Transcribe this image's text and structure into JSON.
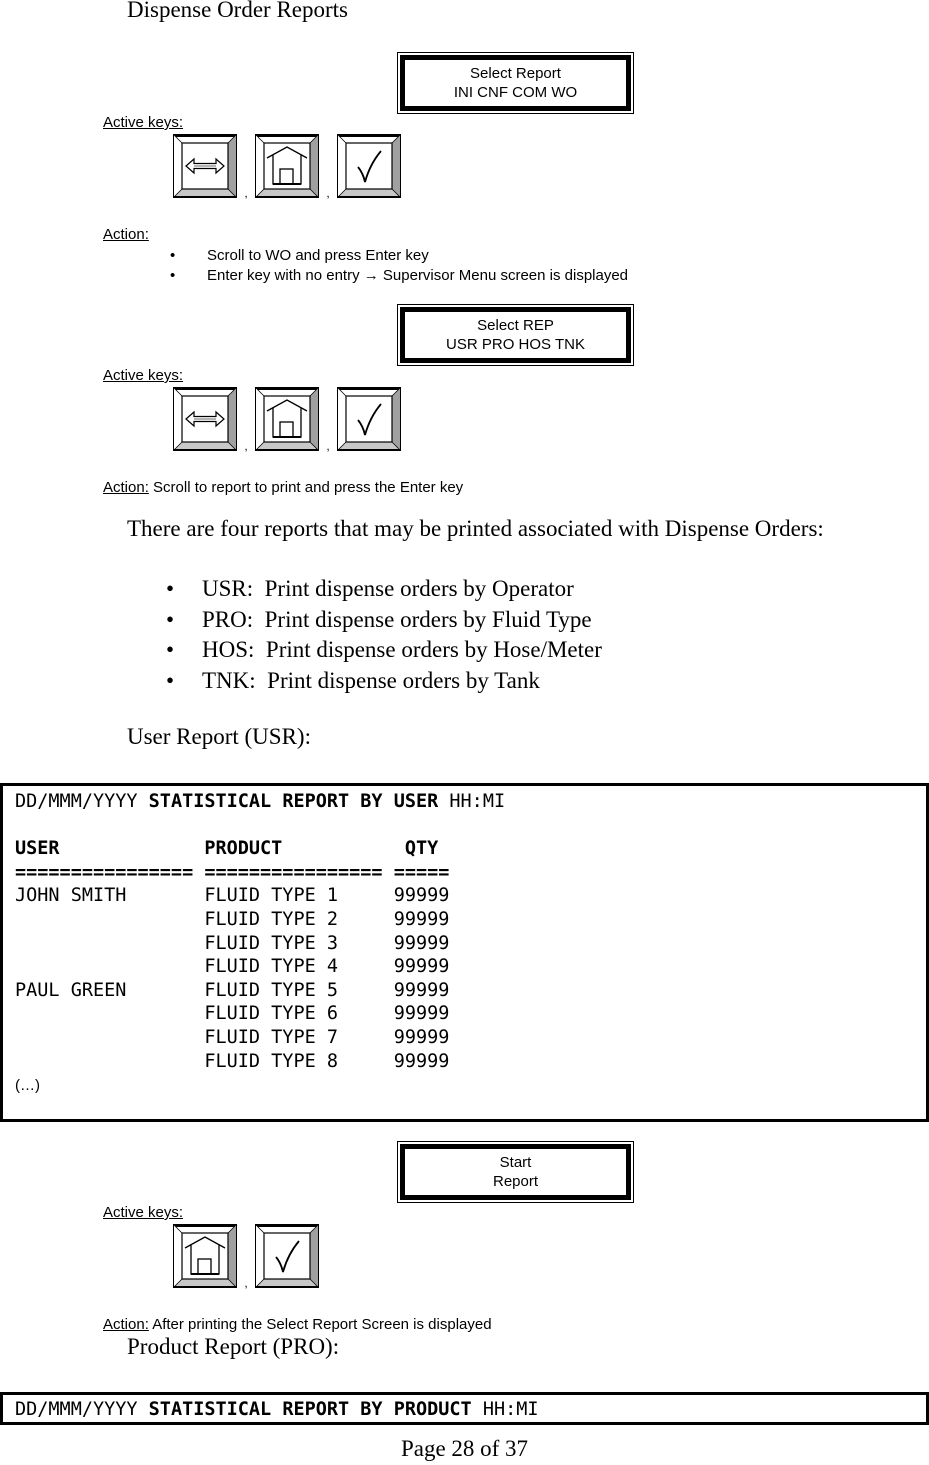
{
  "section_title": "Dispense Order Reports",
  "labels": {
    "active_keys": "Active keys:",
    "action": "Action:"
  },
  "icons": {
    "scroll": "left-right-arrow-icon",
    "home": "home-icon",
    "enter": "check-mark-icon"
  },
  "step1": {
    "screen": {
      "line1": "Select Report",
      "line2": "INI CNF COM WO"
    },
    "keys": [
      "scroll",
      "home",
      "enter"
    ],
    "actions": [
      "Scroll to WO and press Enter key",
      "Enter key with no entry → Supervisor Menu screen is displayed"
    ]
  },
  "step2": {
    "screen": {
      "line1": "Select REP",
      "line2": "USR PRO HOS TNK"
    },
    "keys": [
      "scroll",
      "home",
      "enter"
    ],
    "action": "Scroll to report to print and press the Enter key"
  },
  "intro": "There are four reports that may be printed associated with Dispense Orders:",
  "report_types": [
    "USR:  Print dispense orders by Operator",
    "PRO:  Print dispense orders by Fluid Type",
    "HOS:  Print dispense orders by Hose/Meter",
    "TNK:  Print dispense orders by Tank"
  ],
  "user_report": {
    "heading": "User Report (USR):",
    "title_date": "DD/MMM/YYYY",
    "title_bold": "STATISTICAL REPORT BY USER",
    "title_time": "HH:MI",
    "columns": [
      "USER",
      "PRODUCT",
      "QTY"
    ],
    "separator": [
      "================",
      "================",
      "====="
    ],
    "rows": [
      {
        "user": "JOHN SMITH",
        "product": "FLUID TYPE 1",
        "qty": "99999"
      },
      {
        "user": "",
        "product": "FLUID TYPE 2",
        "qty": "99999"
      },
      {
        "user": "",
        "product": "FLUID TYPE 3",
        "qty": "99999"
      },
      {
        "user": "",
        "product": "FLUID TYPE 4",
        "qty": "99999"
      },
      {
        "user": "PAUL GREEN",
        "product": "FLUID TYPE 5",
        "qty": "99999"
      },
      {
        "user": "",
        "product": "FLUID TYPE 6",
        "qty": "99999"
      },
      {
        "user": "",
        "product": "FLUID TYPE 7",
        "qty": "99999"
      },
      {
        "user": "",
        "product": "FLUID TYPE 8",
        "qty": "99999"
      }
    ],
    "ellipsis": "(…)"
  },
  "step3": {
    "screen": {
      "line1": "Start",
      "line2": "Report"
    },
    "keys": [
      "home",
      "enter"
    ],
    "action": "After printing the Select Report Screen is displayed"
  },
  "product_report": {
    "heading": "Product Report (PRO):",
    "title_date": "DD/MMM/YYYY",
    "title_bold": "STATISTICAL REPORT BY PRODUCT",
    "title_time": "HH:MI"
  },
  "footer": {
    "page": "Page 28 of 37"
  }
}
